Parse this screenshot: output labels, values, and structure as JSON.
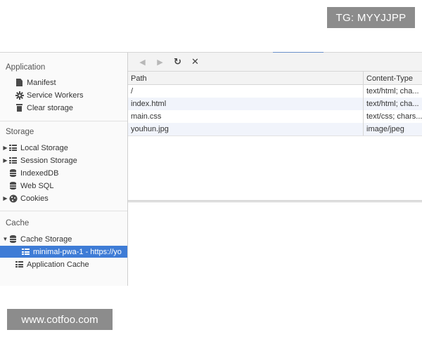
{
  "watermarks": {
    "top": "TG: MYYJJPP",
    "bottom": "www.cotfoo.com"
  },
  "sidebar": {
    "sections": [
      {
        "title": "Application",
        "items": [
          {
            "label": "Manifest",
            "icon": "document-icon"
          },
          {
            "label": "Service Workers",
            "icon": "gear-icon"
          },
          {
            "label": "Clear storage",
            "icon": "trash-icon"
          }
        ]
      },
      {
        "title": "Storage",
        "items": [
          {
            "label": "Local Storage",
            "icon": "grid-icon",
            "expandable": true
          },
          {
            "label": "Session Storage",
            "icon": "grid-icon",
            "expandable": true
          },
          {
            "label": "IndexedDB",
            "icon": "database-icon"
          },
          {
            "label": "Web SQL",
            "icon": "database-icon"
          },
          {
            "label": "Cookies",
            "icon": "cookie-icon",
            "expandable": true
          }
        ]
      },
      {
        "title": "Cache",
        "items": [
          {
            "label": "Cache Storage",
            "icon": "database-icon",
            "expanded": true
          },
          {
            "label": "minimal-pwa-1 - https://yo",
            "icon": "grid-icon",
            "selected": true
          },
          {
            "label": "Application Cache",
            "icon": "grid-icon"
          }
        ]
      }
    ]
  },
  "toolbar": {
    "back_icon": "◀",
    "forward_icon": "▶",
    "refresh_icon": "↻",
    "delete_icon": "✕"
  },
  "table": {
    "columns": [
      "Path",
      "Content-Type"
    ],
    "rows": [
      {
        "path": "/",
        "content_type": "text/html; cha..."
      },
      {
        "path": "index.html",
        "content_type": "text/html; cha..."
      },
      {
        "path": "main.css",
        "content_type": "text/css; chars..."
      },
      {
        "path": "youhun.jpg",
        "content_type": "image/jpeg"
      }
    ]
  },
  "colors": {
    "selection": "#3e7cd6",
    "accent": "#6a8fc9",
    "watermark_bg": "#8c8c8c"
  }
}
